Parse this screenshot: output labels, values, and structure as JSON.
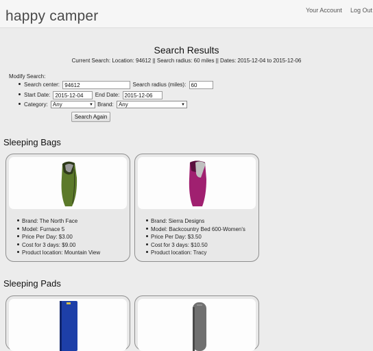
{
  "header": {
    "brand": "happy camper",
    "nav": {
      "account": "Your Account",
      "logout": "Log Out"
    }
  },
  "results": {
    "title": "Search Results",
    "current_search": "Current Search: Location: 94612 || Search radius: 60 miles || Dates: 2015-12-04 to 2015-12-06"
  },
  "form": {
    "modify_label": "Modify Search:",
    "search_center_label": "Search center:",
    "search_center_value": "94612",
    "radius_label": "Search radius (miles):",
    "radius_value": "60",
    "start_label": "Start Date:",
    "start_value": "2015-12-04",
    "end_label": "End Date:",
    "end_value": "2015-12-06",
    "category_label": "Category:",
    "category_value": "Any",
    "brand_label": "Brand:",
    "brand_value": "Any",
    "submit_label": "Search Again"
  },
  "sections": [
    {
      "title": "Sleeping Bags",
      "products": [
        {
          "brand": "Brand: The North Face",
          "model": "Model: Furnace 5",
          "price": "Price Per Day: $3.00",
          "cost": "Cost for 3 days: $9.00",
          "location": "Product location: Mountain View",
          "colors": {
            "body": "#5c7a2a",
            "dark": "#2e3a1a",
            "accent": "#9a9a9a"
          }
        },
        {
          "brand": "Brand: Sierra Designs",
          "model": "Model: Backcountry Bed 600-Women's",
          "price": "Price Per Day: $3.50",
          "cost": "Cost for 3 days: $10.50",
          "location": "Product location: Tracy",
          "colors": {
            "body": "#a02070",
            "dark": "#5a0f3e",
            "accent": "#c0c0c0"
          }
        }
      ]
    },
    {
      "title": "Sleeping Pads",
      "products": [
        {
          "colors": {
            "body": "#1d3fa8",
            "dark": "#10256b",
            "accent": "#d4c04a"
          }
        },
        {
          "colors": {
            "body": "#707070",
            "dark": "#4a4a4a",
            "accent": "#909090"
          }
        }
      ]
    }
  ]
}
